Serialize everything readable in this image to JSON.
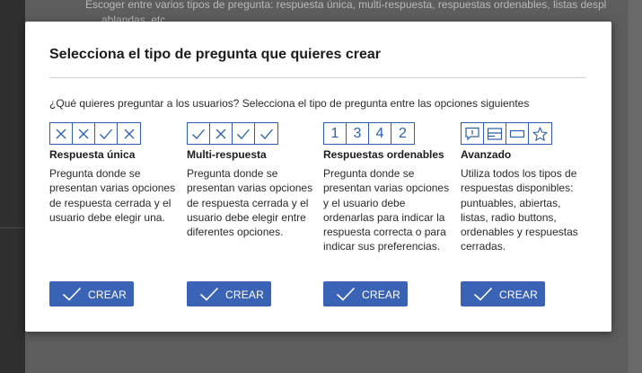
{
  "background": {
    "bullet_text": "Escoger entre varios tipos de pregunta: respuesta única, multi-respuesta, respuestas ordenables, listas despl",
    "second_line": "ablandas, etc."
  },
  "modal": {
    "title": "Selecciona el tipo de pregunta que quieres crear",
    "question": "¿Qué quieres preguntar a los usuarios? Selecciona el tipo de pregunta entre las opciones siguientes",
    "options": [
      {
        "heading": "Respuesta única",
        "description": "Pregunta donde se presentan varias opciones de respuesta cerrada y el usuario debe elegir una.",
        "icons": [
          "cross-icon",
          "cross-icon",
          "check-icon",
          "cross-icon"
        ],
        "button": "CREAR"
      },
      {
        "heading": "Multi-respuesta",
        "description": "Pregunta donde se presentan varias opciones de respuesta cerrada y el usuario debe elegir entre diferentes opciones.",
        "icons": [
          "check-icon",
          "cross-icon",
          "check-icon",
          "check-icon"
        ],
        "button": "CREAR"
      },
      {
        "heading": "Respuestas ordenables",
        "description": "Pregunta donde se presentan varias opciones y el usuario debe ordenarlas para indicar la respuesta correcta o para indicar sus preferencias.",
        "numbers": [
          "1",
          "3",
          "4",
          "2"
        ],
        "button": "CREAR"
      },
      {
        "heading": "Avanzado",
        "description": "Utiliza todos los tipos de respuestas disponibles: puntuables, abiertas, listas, radio buttons, ordenables y respuestas cerradas.",
        "icons": [
          "speech-bubble-icon",
          "card-icon",
          "input-box-icon",
          "star-icon"
        ],
        "button": "CREAR"
      }
    ]
  },
  "colors": {
    "accent": "#3b63b5",
    "icon_stroke": "#2e5faa"
  }
}
